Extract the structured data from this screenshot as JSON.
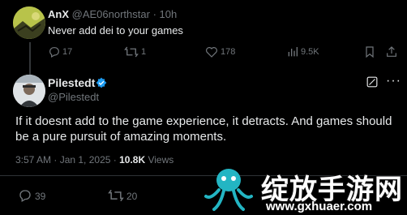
{
  "reply_context": {
    "display_name": "AnX",
    "handle": "@AE06northstar",
    "separator": "·",
    "time": "10h",
    "text": "Never add dei to your games",
    "stats": {
      "replies": "17",
      "reposts": "1",
      "likes": "178",
      "views": "9.5K"
    }
  },
  "main_post": {
    "display_name": "Pilestedt",
    "handle": "@Pilestedt",
    "verified": true,
    "text_line1": "If it doesnt add to the game experience, it detracts. And games should",
    "text_line2": "be a pure pursuit of amazing moments.",
    "timestamp": "3:57 AM · Jan 1, 2025 ·",
    "views_count": "10.8K",
    "views_label": "Views",
    "stats": {
      "replies": "39",
      "reposts": "20"
    }
  },
  "watermark": {
    "cn_text": "绽放手游网",
    "url_text": "www.gxhuaer.com"
  },
  "colors": {
    "background": "#000000",
    "text": "#e7e9ea",
    "muted": "#71767b",
    "verified": "#1d9bf0",
    "watermark_teal": "#23b5c3"
  }
}
